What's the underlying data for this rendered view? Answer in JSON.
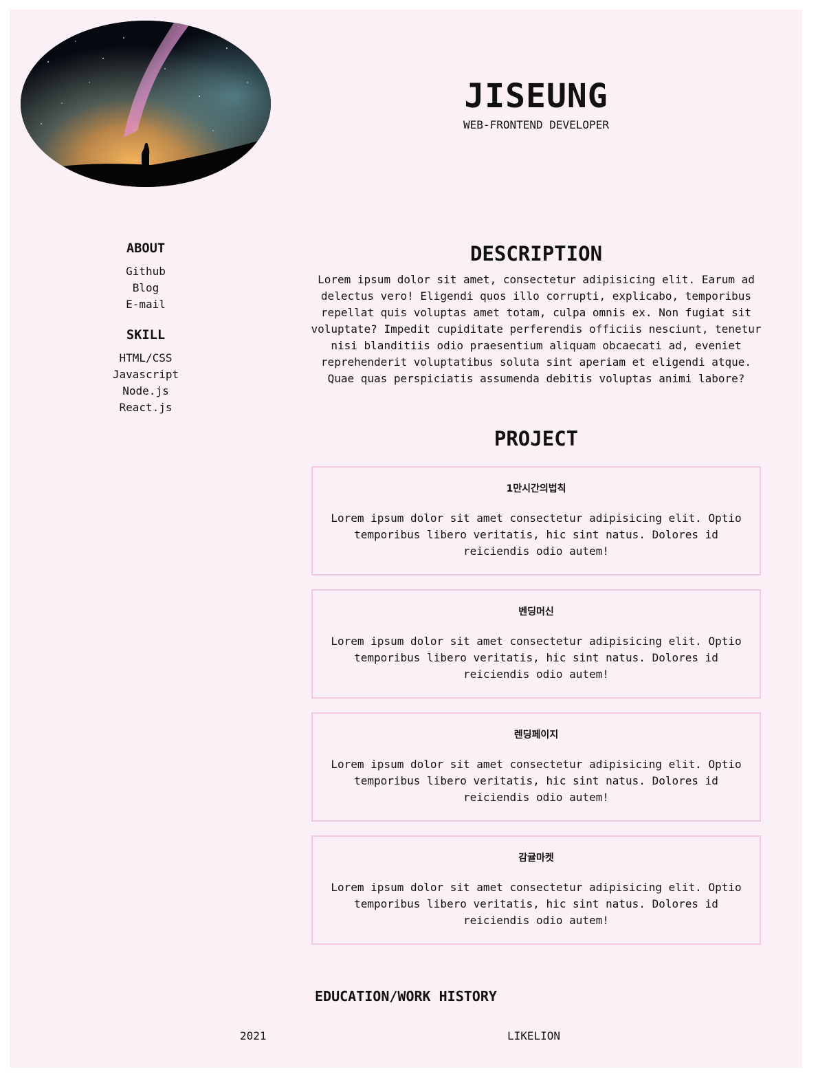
{
  "header": {
    "name": "JISEUNG",
    "role": "WEB-FRONTEND DEVELOPER",
    "photo_icon": "milky-way-photo"
  },
  "sidebar": {
    "about_title": "ABOUT",
    "about_links": [
      "Github",
      "Blog",
      "E-mail"
    ],
    "skill_title": "SKILL",
    "skills": [
      "HTML/CSS",
      "Javascript",
      "Node.js",
      "React.js"
    ]
  },
  "description": {
    "title": "DESCRIPTION",
    "text": "Lorem ipsum dolor sit amet, consectetur adipisicing elit. Earum ad delectus vero! Eligendi quos illo corrupti, explicabo, temporibus repellat quis voluptas amet totam, culpa omnis ex. Non fugiat sit voluptate? Impedit cupiditate perferendis officiis nesciunt, tenetur nisi blanditiis odio praesentium aliquam obcaecati ad, eveniet reprehenderit voluptatibus soluta sint aperiam et eligendi atque. Quae quas perspiciatis assumenda debitis voluptas animi labore?"
  },
  "project": {
    "title": "PROJECT",
    "items": [
      {
        "name": "1만시간의법칙",
        "desc": "Lorem ipsum dolor sit amet consectetur adipisicing elit. Optio temporibus libero veritatis, hic sint natus. Dolores id reiciendis odio autem!"
      },
      {
        "name": "벤딩머신",
        "desc": "Lorem ipsum dolor sit amet consectetur adipisicing elit. Optio temporibus libero veritatis, hic sint natus. Dolores id reiciendis odio autem!"
      },
      {
        "name": "렌딩페이지",
        "desc": "Lorem ipsum dolor sit amet consectetur adipisicing elit. Optio temporibus libero veritatis, hic sint natus. Dolores id reiciendis odio autem!"
      },
      {
        "name": "감귤마켓",
        "desc": "Lorem ipsum dolor sit amet consectetur adipisicing elit. Optio temporibus libero veritatis, hic sint natus. Dolores id reiciendis odio autem!"
      }
    ]
  },
  "history": {
    "title": "EDUCATION/WORK HISTORY",
    "year": "2021",
    "org": "LIKELION"
  },
  "colors": {
    "background": "#fbf0f6",
    "card_border": "#f2c9e0",
    "text": "#111111"
  }
}
